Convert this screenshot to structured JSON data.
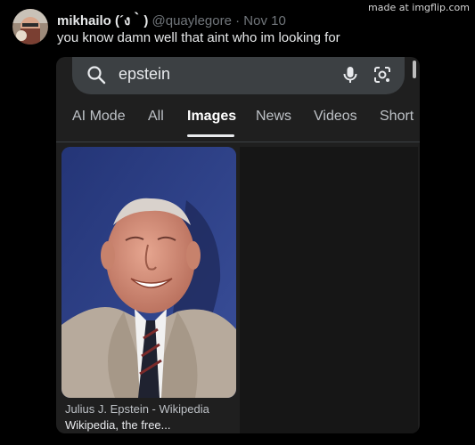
{
  "watermark": "made at imgflip.com",
  "tweet": {
    "display_name": "mikhailo (´ง｀)",
    "handle": "@quaylegore",
    "separator": "·",
    "date": "Nov 10",
    "text": "you know damn well that aint who im looking for"
  },
  "search": {
    "query": "epstein"
  },
  "tabs": [
    {
      "label": "AI Mode",
      "active": false
    },
    {
      "label": "All",
      "active": false
    },
    {
      "label": "Images",
      "active": true
    },
    {
      "label": "News",
      "active": false
    },
    {
      "label": "Videos",
      "active": false
    },
    {
      "label": "Short",
      "active": false
    }
  ],
  "result": {
    "title": "Julius J. Epstein - Wikipedia",
    "source": "Wikipedia, the free..."
  }
}
